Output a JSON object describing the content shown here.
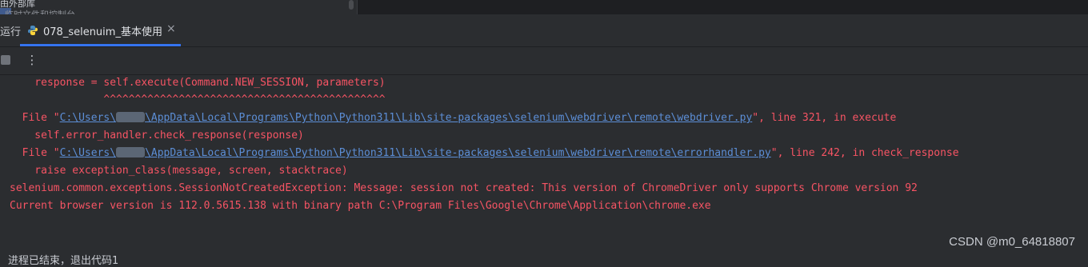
{
  "project_panel": {
    "line1": "由外部库",
    "line2": "临时文件和控制台"
  },
  "run_window": {
    "run_label": "运行",
    "active_tab": {
      "label": "078_selenuim_基本使用",
      "icon": "python-icon",
      "close_glyph": "×"
    },
    "toolbar": {
      "stop_icon": "stop-icon",
      "more_glyph": "⋮"
    }
  },
  "console": {
    "lines": {
      "l0": "    response = self.execute(Command.NEW_SESSION, parameters)",
      "l1": "               ^^^^^^^^^^^^^^^^^^^^^^^^^^^^^^^^^^^^^^^^^^^^^",
      "l2_prefix": "  File \"",
      "l2_link_a": "C:\\Users\\",
      "l2_link_b": "\\AppData\\Local\\Programs\\Python\\Python311\\Lib\\site-packages\\selenium\\webdriver\\remote\\webdriver.py",
      "l2_suffix": "\", line 321, in execute",
      "l3": "    self.error_handler.check_response(response)",
      "l4_prefix": "  File \"",
      "l4_link_a": "C:\\Users\\",
      "l4_link_b": "\\AppData\\Local\\Programs\\Python\\Python311\\Lib\\site-packages\\selenium\\webdriver\\remote\\errorhandler.py",
      "l4_suffix": "\", line 242, in check_response",
      "l5": "    raise exception_class(message, screen, stacktrace)",
      "l6": "selenium.common.exceptions.SessionNotCreatedException: Message: session not created: This version of ChromeDriver only supports Chrome version 92",
      "l7": "Current browser version is 112.0.5615.138 with binary path C:\\Program Files\\Google\\Chrome\\Application\\chrome.exe"
    },
    "exit_message": "进程已结束，退出代码1"
  },
  "watermark": "CSDN @m0_64818807",
  "colors": {
    "background": "#2b2d30",
    "error_text": "#f75464",
    "link": "#5c8ed6",
    "tab_accent": "#3574f0"
  }
}
